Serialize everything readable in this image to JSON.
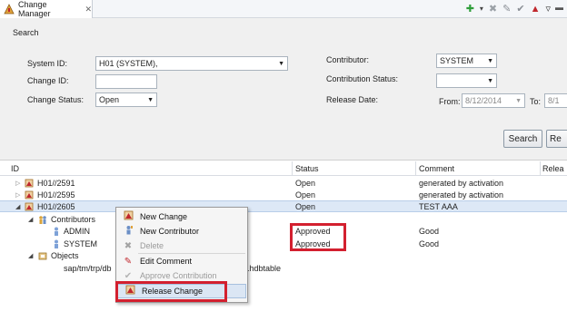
{
  "view": {
    "title": "Change Manager",
    "close": "✕"
  },
  "toolbar": {
    "add": "✚",
    "dropdown": "▾",
    "delete": "✖",
    "edit": "✎",
    "approve": "✔",
    "release": "▲",
    "menu": "▿"
  },
  "search": {
    "section_title": "Search",
    "system_id_label": "System ID:",
    "system_id_value": "H01 (SYSTEM),",
    "change_id_label": "Change ID:",
    "change_id_value": "",
    "change_status_label": "Change Status:",
    "change_status_value": "Open",
    "contributor_label": "Contributor:",
    "contributor_value": "SYSTEM",
    "contribution_status_label": "Contribution Status:",
    "contribution_status_value": "",
    "release_date_label": "Release Date:",
    "from_label": "From:",
    "from_value": "8/12/2014",
    "to_label": "To:",
    "to_value": "8/1",
    "search_button": "Search",
    "reset_button": "Re"
  },
  "table": {
    "columns": [
      "ID",
      "Status",
      "Comment",
      "Relea"
    ],
    "rows": [
      {
        "id": "H01//2591",
        "status": "Open",
        "comment": "generated by activation"
      },
      {
        "id": "H01//2595",
        "status": "Open",
        "comment": "generated by activation"
      },
      {
        "id": "H01//2605",
        "status": "Open",
        "comment": "TEST AAA"
      }
    ],
    "contributors_label": "Contributors",
    "contributors": [
      {
        "name": "ADMIN",
        "status": "Approved",
        "comment": "Good"
      },
      {
        "name": "SYSTEM",
        "status": "Approved",
        "comment": "Good"
      }
    ],
    "objects_label": "Objects",
    "object_path_start": "sap/tm/trp/db",
    "object_path_end": ".hdbtable"
  },
  "context_menu": {
    "items": [
      {
        "label": "New Change",
        "icon": "new-change-icon"
      },
      {
        "label": "New Contributor",
        "icon": "new-contributor-icon"
      },
      {
        "label": "Delete",
        "icon": "delete-icon"
      },
      {
        "label": "Edit Comment",
        "icon": "edit-icon"
      },
      {
        "label": "Approve Contribution",
        "icon": "approve-icon"
      },
      {
        "label": "Release Change",
        "icon": "release-icon"
      }
    ]
  },
  "colors": {
    "highlight_box": "#d3202f",
    "selected_row": "#dde8f6"
  }
}
